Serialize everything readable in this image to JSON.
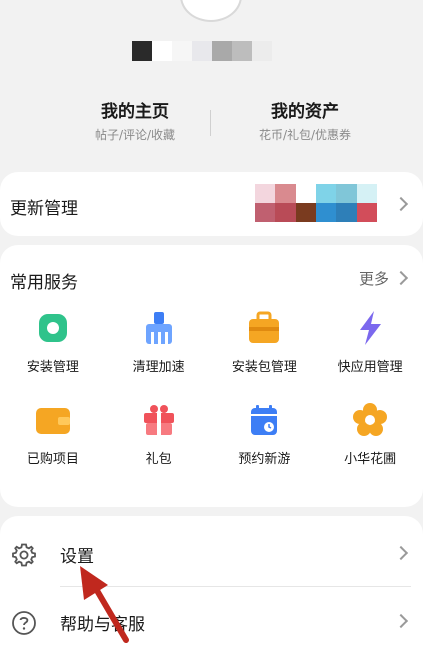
{
  "profile": {
    "nickname_masked": true,
    "my_home": {
      "title": "我的主页",
      "subtitle": "帖子/评论/收藏"
    },
    "my_assets": {
      "title": "我的资产",
      "subtitle": "花币/礼包/优惠券"
    }
  },
  "update_manager": {
    "label": "更新管理"
  },
  "services": {
    "title": "常用服务",
    "more_label": "更多",
    "items": [
      {
        "label": "安装管理",
        "icon": "install-manage-icon",
        "color": "#2fc38b"
      },
      {
        "label": "清理加速",
        "icon": "clean-boost-icon",
        "color": "#3d7ef5"
      },
      {
        "label": "安装包管理",
        "icon": "package-manage-icon",
        "color": "#f5a623"
      },
      {
        "label": "快应用管理",
        "icon": "quick-app-icon",
        "color": "#7b68ee"
      },
      {
        "label": "已购项目",
        "icon": "purchased-icon",
        "color": "#f5a623"
      },
      {
        "label": "礼包",
        "icon": "gift-icon",
        "color": "#f0525a"
      },
      {
        "label": "预约新游",
        "icon": "reserve-game-icon",
        "color": "#3d7ef5"
      },
      {
        "label": "小华花圃",
        "icon": "flower-garden-icon",
        "color": "#f5a623"
      }
    ]
  },
  "menu": {
    "settings": {
      "label": "设置",
      "icon": "gear-icon"
    },
    "help": {
      "label": "帮助与客服",
      "icon": "help-icon"
    }
  },
  "colors": {
    "background": "#f2f2f2",
    "card": "#ffffff",
    "annotation_arrow": "#c0281e"
  }
}
